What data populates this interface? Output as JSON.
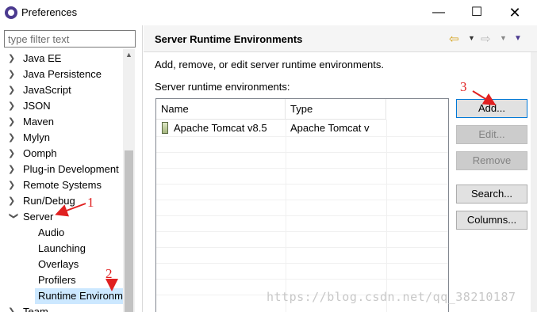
{
  "window": {
    "title": "Preferences",
    "icon": "eclipse-icon",
    "minimize": "—",
    "maximize": "☐",
    "close": "✕"
  },
  "sidebar": {
    "filter_placeholder": "type filter text",
    "items": [
      {
        "label": "Java EE",
        "expanded": false
      },
      {
        "label": "Java Persistence",
        "expanded": false
      },
      {
        "label": "JavaScript",
        "expanded": false
      },
      {
        "label": "JSON",
        "expanded": false
      },
      {
        "label": "Maven",
        "expanded": false
      },
      {
        "label": "Mylyn",
        "expanded": false
      },
      {
        "label": "Oomph",
        "expanded": false
      },
      {
        "label": "Plug-in Development",
        "expanded": false
      },
      {
        "label": "Remote Systems",
        "expanded": false
      },
      {
        "label": "Run/Debug",
        "expanded": false
      },
      {
        "label": "Server",
        "expanded": true
      },
      {
        "label": "Audio",
        "child": true
      },
      {
        "label": "Launching",
        "child": true
      },
      {
        "label": "Overlays",
        "child": true
      },
      {
        "label": "Profilers",
        "child": true
      },
      {
        "label": "Runtime Environm",
        "child": true,
        "selected": true
      },
      {
        "label": "Team",
        "expanded": false
      }
    ]
  },
  "main": {
    "title": "Server Runtime Environments",
    "description": "Add, remove, or edit server runtime environments.",
    "list_label": "Server runtime environments:",
    "table": {
      "columns": [
        "Name",
        "Type"
      ],
      "rows": [
        {
          "name": "Apache Tomcat v8.5",
          "type": "Apache Tomcat v"
        }
      ]
    },
    "buttons": {
      "add": "Add...",
      "edit": "Edit...",
      "remove": "Remove",
      "search": "Search...",
      "columns": "Columns..."
    }
  },
  "annotations": {
    "one": "1",
    "two": "2",
    "three": "3",
    "color": "#e02020"
  },
  "watermark": "https://blog.csdn.net/qq_38210187"
}
